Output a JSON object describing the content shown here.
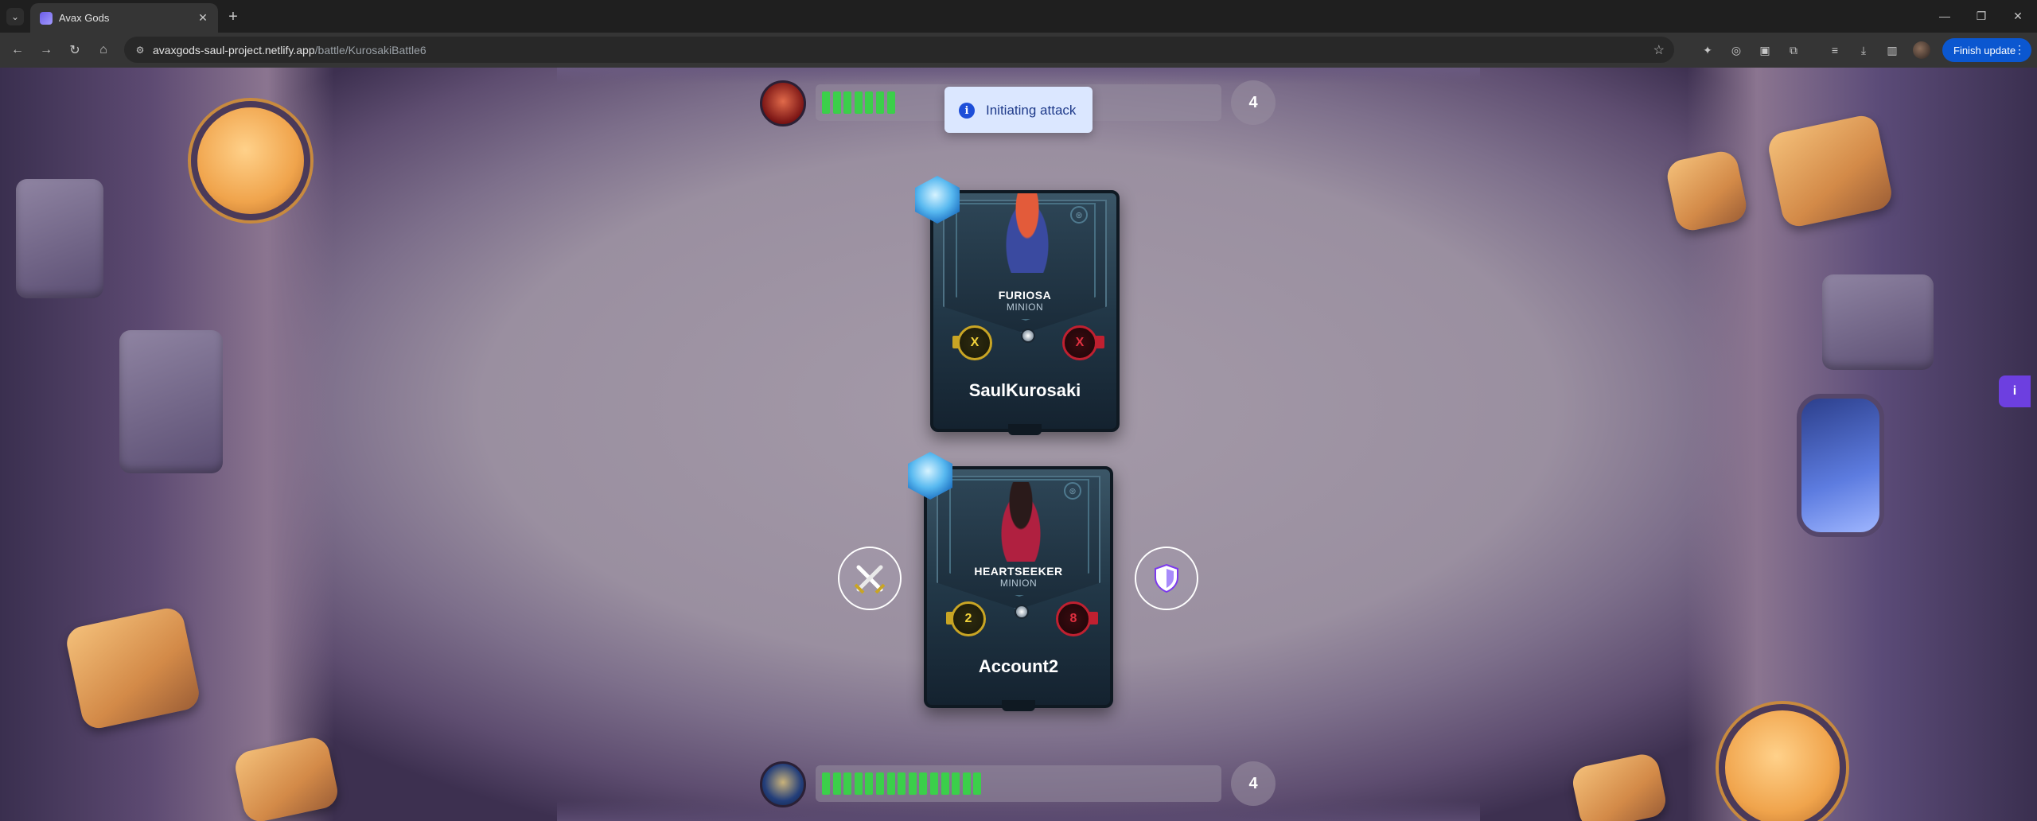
{
  "browser": {
    "tab_title": "Avax Gods",
    "url_host": "avaxgods-saul-project.netlify.app",
    "url_path": "/battle/KurosakiBattle6",
    "finish_update_label": "Finish update",
    "icons": [
      "tab-list-icon",
      "close-icon",
      "plus-icon",
      "back-icon",
      "forward-icon",
      "reload-icon",
      "home-icon",
      "site-info-icon",
      "star-icon",
      "extension-icon",
      "downloads-icon",
      "side-panel-icon",
      "menu-icon"
    ]
  },
  "toast": {
    "message": "Initiating attack",
    "icon": "info-icon"
  },
  "enemy": {
    "health_count": "4",
    "health_fraction": 0.19,
    "card": {
      "name": "FURIOSA",
      "type": "MINION",
      "attack": "X",
      "defense": "X",
      "owner": "SaulKurosaki"
    }
  },
  "player": {
    "health_count": "4",
    "health_fraction": 0.43,
    "card": {
      "name": "HEARTSEEKER",
      "type": "MINION",
      "attack": "2",
      "defense": "8",
      "owner": "Account2"
    }
  },
  "actions": {
    "attack_icon": "crossed-swords-icon",
    "defend_icon": "shield-icon"
  },
  "colors": {
    "health": "#3bcf4a",
    "toast_bg": "#dbe7ff",
    "accent": "#0b57d0"
  }
}
